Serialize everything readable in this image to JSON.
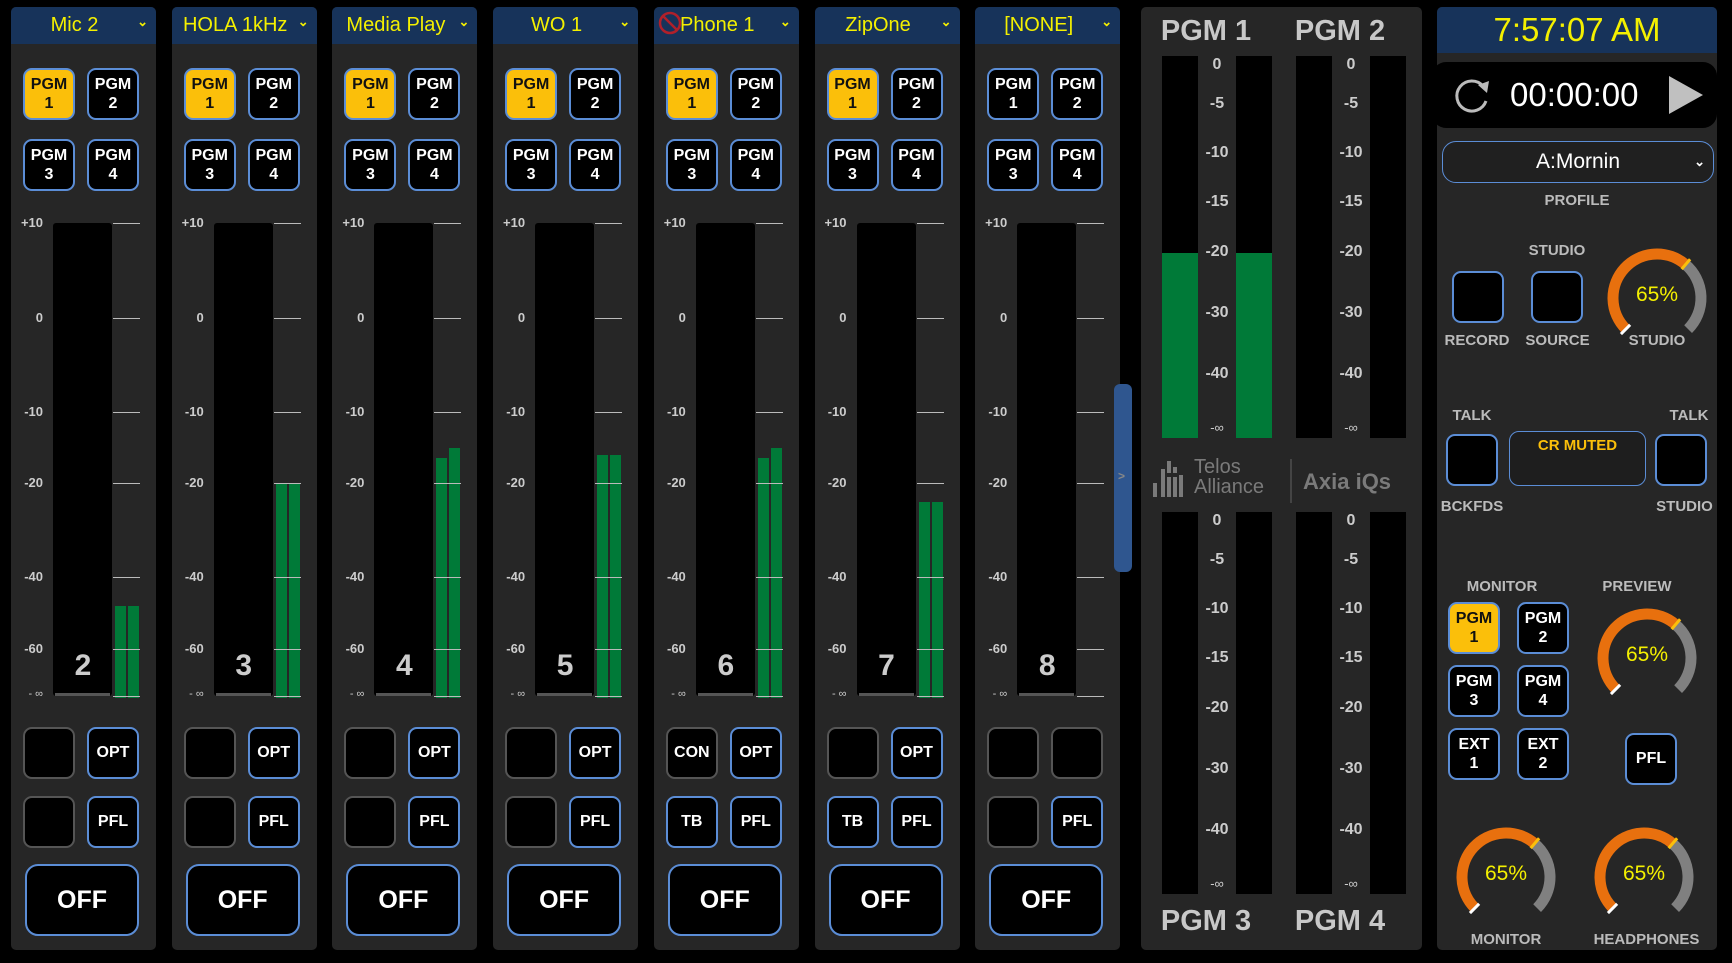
{
  "channels": [
    {
      "number": "2",
      "name": "Mic 2",
      "blocked": false,
      "pgm": [
        true,
        false,
        false,
        false
      ],
      "btn_a": "",
      "btn_a_active": false,
      "btn_b": "OPT",
      "btn_c": "",
      "btn_c_active": false,
      "btn_d": "PFL",
      "off_label": "OFF",
      "level_db": [
        -48,
        -48
      ]
    },
    {
      "number": "3",
      "name": "HOLA 1kHz",
      "blocked": false,
      "pgm": [
        true,
        false,
        false,
        false
      ],
      "btn_a": "",
      "btn_a_active": false,
      "btn_b": "OPT",
      "btn_c": "",
      "btn_c_active": false,
      "btn_d": "PFL",
      "off_label": "OFF",
      "level_db": [
        -20,
        -20
      ]
    },
    {
      "number": "4",
      "name": "Media Play",
      "blocked": false,
      "pgm": [
        true,
        false,
        false,
        false
      ],
      "btn_a": "",
      "btn_a_active": false,
      "btn_b": "OPT",
      "btn_c": "",
      "btn_c_active": false,
      "btn_d": "PFL",
      "off_label": "OFF",
      "level_db": [
        -16.5,
        -15
      ]
    },
    {
      "number": "5",
      "name": "WO 1",
      "blocked": false,
      "pgm": [
        true,
        false,
        false,
        false
      ],
      "btn_a": "",
      "btn_a_active": false,
      "btn_b": "OPT",
      "btn_c": "",
      "btn_c_active": false,
      "btn_d": "PFL",
      "off_label": "OFF",
      "level_db": [
        -16,
        -16
      ]
    },
    {
      "number": "6",
      "name": "Phone 1",
      "blocked": true,
      "pgm": [
        true,
        false,
        false,
        false
      ],
      "btn_a": "CON",
      "btn_a_active": false,
      "btn_b": "OPT",
      "btn_c": "TB",
      "btn_c_active": true,
      "btn_d": "PFL",
      "off_label": "OFF",
      "level_db": [
        -16.5,
        -15
      ]
    },
    {
      "number": "7",
      "name": "ZipOne",
      "blocked": false,
      "pgm": [
        true,
        false,
        false,
        false
      ],
      "btn_a": "",
      "btn_a_active": false,
      "btn_b": "OPT",
      "btn_c": "TB",
      "btn_c_active": true,
      "btn_d": "PFL",
      "off_label": "OFF",
      "level_db": [
        -24,
        -24
      ]
    },
    {
      "number": "8",
      "name": "[NONE]",
      "blocked": false,
      "pgm": [
        false,
        false,
        false,
        false
      ],
      "btn_a": "",
      "btn_a_active": false,
      "btn_b": "",
      "btn_c": "",
      "btn_c_active": false,
      "btn_d": "PFL",
      "off_label": "OFF",
      "level_db": null
    }
  ],
  "pgm_button_labels": [
    [
      "PGM",
      "1"
    ],
    [
      "PGM",
      "2"
    ],
    [
      "PGM",
      "3"
    ],
    [
      "PGM",
      "4"
    ]
  ],
  "channel_scale": [
    "+10",
    "0",
    "-10",
    "-20",
    "-40",
    "-60",
    "- ∞"
  ],
  "pgm_meters": [
    {
      "title": "PGM 1",
      "level_db": [
        -20,
        -20
      ]
    },
    {
      "title": "PGM 2",
      "level_db": null
    },
    {
      "title": "PGM 3",
      "level_db": null
    },
    {
      "title": "PGM 4",
      "level_db": null
    }
  ],
  "pgm_scale": [
    "0",
    "-5",
    "-10",
    "-15",
    "-20",
    "-30",
    "-40",
    "-∞"
  ],
  "logos": {
    "telos_line1": "Telos",
    "telos_line2": "Alliance",
    "axia": "Axia iQs"
  },
  "right_panel": {
    "clock": "7:57:07 AM",
    "timer": "00:00:00",
    "profile_value": "A:Mornin",
    "profile_label": "PROFILE",
    "studio_header": "STUDIO",
    "record_label": "RECORD",
    "source_label": "SOURCE",
    "studio_knob": {
      "value": "65%",
      "percent": 65,
      "label": "STUDIO"
    },
    "talk_left_label": "TALK",
    "talk_left_sub": "BCKFDS",
    "talk_right_label": "TALK",
    "talk_right_sub": "STUDIO",
    "cr_status": "CR MUTED",
    "monitor_label": "MONITOR",
    "preview_label": "PREVIEW",
    "monitor_buttons": [
      {
        "l1": "PGM",
        "l2": "1",
        "on": true
      },
      {
        "l1": "PGM",
        "l2": "2",
        "on": false
      },
      {
        "l1": "PGM",
        "l2": "3",
        "on": false
      },
      {
        "l1": "PGM",
        "l2": "4",
        "on": false
      },
      {
        "l1": "EXT",
        "l2": "1",
        "on": false
      },
      {
        "l1": "EXT",
        "l2": "2",
        "on": false
      }
    ],
    "preview_knob": {
      "value": "65%",
      "percent": 65
    },
    "preview_pfl": "PFL",
    "monitor_knob": {
      "value": "65%",
      "percent": 65,
      "label": "MONITOR"
    },
    "headphones_knob": {
      "value": "65%",
      "percent": 65,
      "label": "HEADPHONES"
    }
  },
  "colors": {
    "accent_on": "#fbbf0a",
    "meter_green": "#007a38",
    "header_blue": "#17335a",
    "label_yellow": "#f4f000",
    "knob_orange": "#e8700e"
  }
}
